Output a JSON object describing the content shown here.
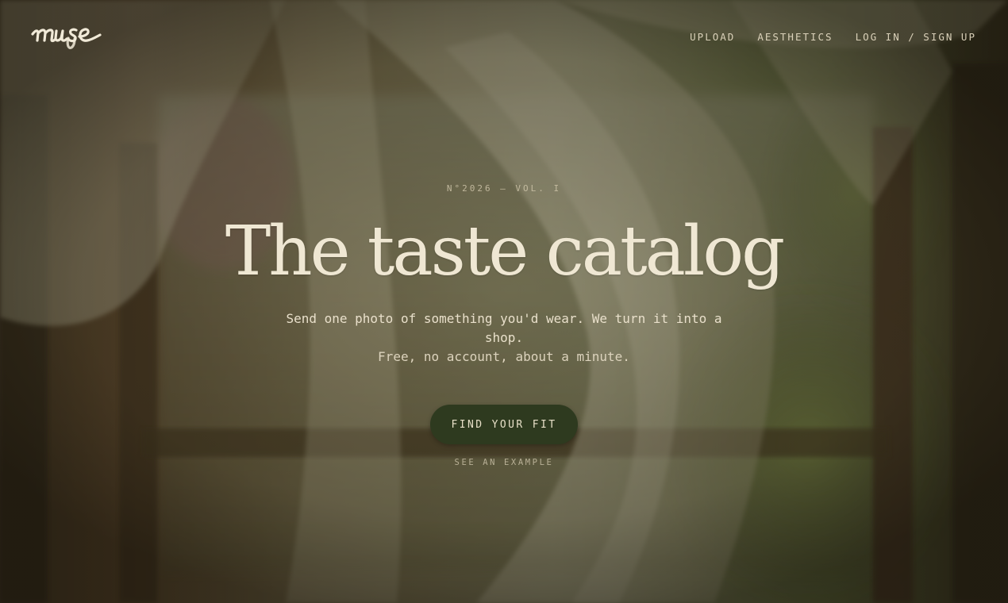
{
  "header": {
    "logo_text": "muse",
    "nav": [
      {
        "label": "UPLOAD"
      },
      {
        "label": "AESTHETICS"
      },
      {
        "label": "LOG IN / SIGN UP"
      }
    ]
  },
  "hero": {
    "issue": "N°2026 — VOL. I",
    "title": "The taste catalog",
    "subtitle_line1": "Send one photo of something you'd wear. We turn it into a shop.",
    "subtitle_line2": "Free, no account, about a minute.",
    "cta_label": "FIND YOUR FIT",
    "example_label": "SEE AN EXAMPLE"
  },
  "colors": {
    "accent": "#2e3a1f",
    "cream_text": "#efe7d3",
    "background": "#4e4a2e"
  }
}
